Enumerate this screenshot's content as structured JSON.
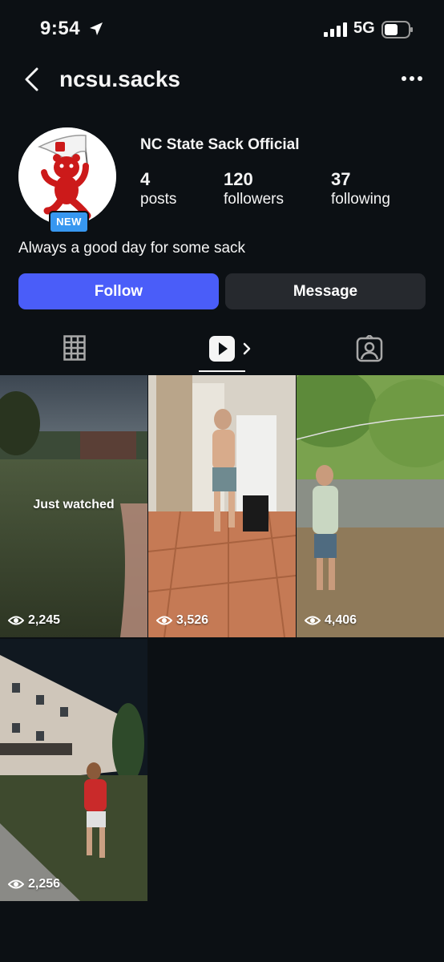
{
  "status_bar": {
    "time": "9:54",
    "network": "5G"
  },
  "header": {
    "username": "ncsu.sacks"
  },
  "profile": {
    "display_name": "NC State Sack Official",
    "badge": "NEW",
    "stats": [
      {
        "value": "4",
        "label": "posts"
      },
      {
        "value": "120",
        "label": "followers"
      },
      {
        "value": "37",
        "label": "following"
      }
    ],
    "bio": "Always a good day for some sack"
  },
  "actions": {
    "follow_label": "Follow",
    "message_label": "Message"
  },
  "tabs": [
    {
      "icon": "grid-icon"
    },
    {
      "icon": "reels-icon",
      "active": true
    },
    {
      "icon": "tagged-icon"
    }
  ],
  "reels": [
    {
      "views": "2,245",
      "overlay": "Just watched"
    },
    {
      "views": "3,526"
    },
    {
      "views": "4,406"
    },
    {
      "views": "2,256"
    }
  ],
  "colors": {
    "background": "#0c1014",
    "follow": "#4a5df9",
    "message": "#26292e",
    "badge": "#3797f0"
  }
}
